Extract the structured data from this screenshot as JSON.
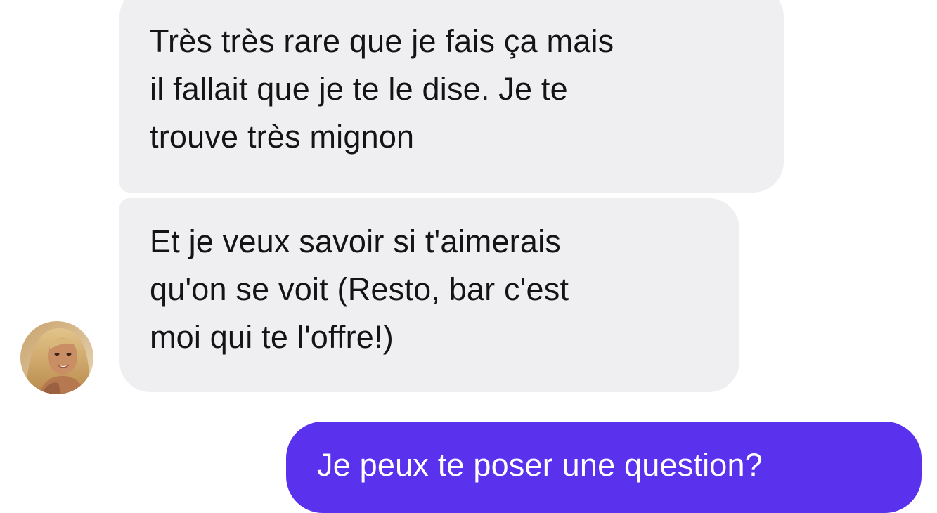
{
  "conversation": {
    "messages": [
      {
        "sender": "contact",
        "text": "Très très rare que je fais ça mais\nil fallait que je te le dise. Je te\ntrouve très mignon"
      },
      {
        "sender": "contact",
        "text": "Et je veux savoir si t'aimerais\nqu'on se voit (Resto, bar c'est\nmoi qui te l'offre!)"
      },
      {
        "sender": "me",
        "text": "Je peux te poser une question?"
      }
    ],
    "contact_avatar": {
      "icon": "profile-photo"
    }
  },
  "colors": {
    "received_bubble": "#efeff2",
    "received_text": "#141414",
    "sent_bubble": "#5a32ee",
    "sent_text": "#ffffff",
    "background": "#ffffff"
  }
}
